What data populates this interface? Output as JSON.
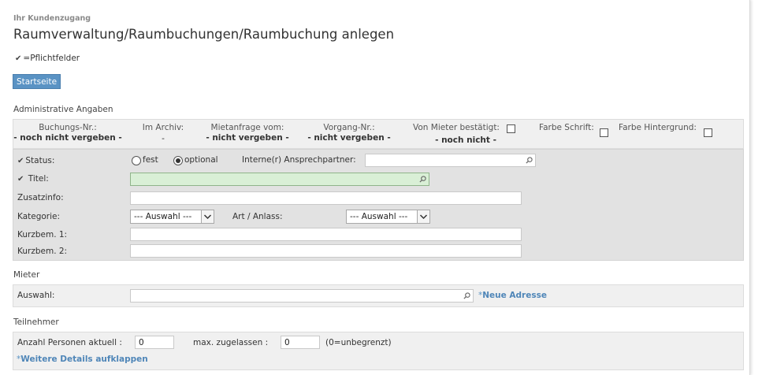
{
  "header": {
    "kicker": "Ihr Kundenzugang",
    "title": "Raumverwaltung/Raumbuchungen/Raumbuchung anlegen",
    "required_note": "=Pflichtfelder",
    "home_button": "Startseite"
  },
  "admin": {
    "section_label": "Administrative Angaben",
    "columns": [
      {
        "header": "Buchungs-Nr.:",
        "value": "- noch nicht vergeben -"
      },
      {
        "header": "Im Archiv:",
        "value": "-"
      },
      {
        "header": "Mietanfrage vom:",
        "value": "- nicht vergeben -"
      },
      {
        "header": "Vorgang-Nr.:",
        "value": "- nicht vergeben -"
      },
      {
        "header": "Von Mieter bestätigt:",
        "value": "- noch nicht -"
      },
      {
        "header": "Farbe Schrift:",
        "value": ""
      },
      {
        "header": "Farbe Hintergrund:",
        "value": ""
      }
    ]
  },
  "form": {
    "status_label": "Status:",
    "status_options": [
      "fest",
      "optional"
    ],
    "status_selected": "optional",
    "contact_label": "Interne(r) Ansprechpartner:",
    "contact_value": "",
    "title_label": "Titel:",
    "title_value": "",
    "extra_label": "Zusatzinfo:",
    "extra_value": "",
    "category_label": "Kategorie:",
    "category_value": "--- Auswahl ---",
    "type_label": "Art / Anlass:",
    "type_value": "--- Auswahl ---",
    "short1_label": "Kurzbem. 1:",
    "short1_value": "",
    "short2_label": "Kurzbem. 2:",
    "short2_value": ""
  },
  "tenant": {
    "section_label": "Mieter",
    "select_label": "Auswahl:",
    "select_value": "",
    "new_address_link": "Neue Adresse"
  },
  "participants": {
    "section_label": "Teilnehmer",
    "current_label": "Anzahl Personen aktuell :",
    "current_value": "0",
    "max_label": "max. zugelassen :",
    "max_value": "0",
    "max_hint": "(0=unbegrenzt)",
    "details_link": "Weitere Details aufklappen"
  },
  "icons": {
    "required": "check-icon",
    "search": "magnifier-icon",
    "dropdown": "chevron-down-icon",
    "link_marker": "asterisk-icon"
  },
  "colors": {
    "button_bg": "#5a93c4",
    "link": "#4f86b8",
    "title_field_bg": "#d9efd6",
    "panel_light": "#f0f0f0",
    "panel_dark": "#e2e2e2"
  }
}
